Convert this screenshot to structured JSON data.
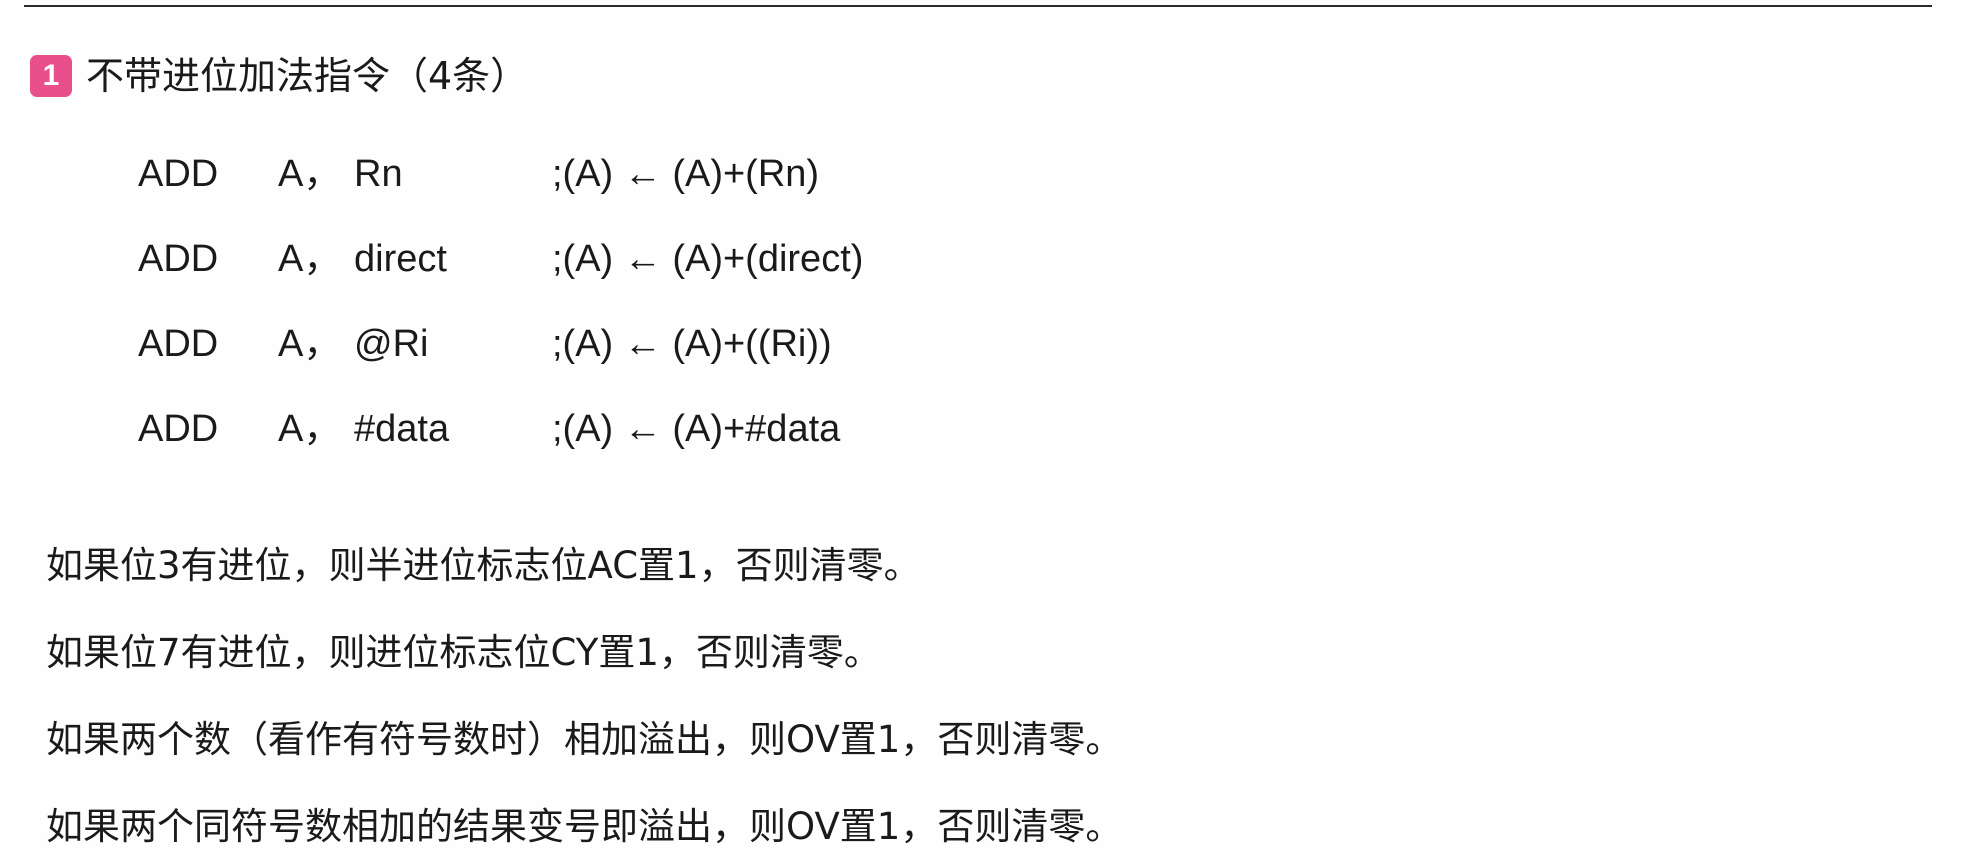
{
  "section": {
    "number": "1",
    "title": "不带进位加法指令（4条）"
  },
  "instructions": [
    {
      "op": "ADD",
      "dest": "A，",
      "src": "Rn",
      "comment": ";(A) ← (A)+(Rn)"
    },
    {
      "op": "ADD",
      "dest": "A，",
      "src": "direct",
      "comment": ";(A) ← (A)+(direct)"
    },
    {
      "op": "ADD",
      "dest": "A，",
      "src": "@Ri",
      "comment": ";(A) ← (A)+((Ri))"
    },
    {
      "op": "ADD",
      "dest": "A，",
      "src": "#data",
      "comment": ";(A) ← (A)+#data"
    }
  ],
  "notes": [
    "如果位3有进位，则半进位标志位AC置1，否则清零。",
    "如果位7有进位，则进位标志位CY置1，否则清零。",
    "如果两个数（看作有符号数时）相加溢出，则OV置1，否则清零。",
    "如果两个同符号数相加的结果变号即溢出，则OV置1，否则清零。"
  ],
  "colors": {
    "badge": "#e94f8a",
    "text": "#1a1a1a",
    "rule": "#2b2b2b"
  }
}
